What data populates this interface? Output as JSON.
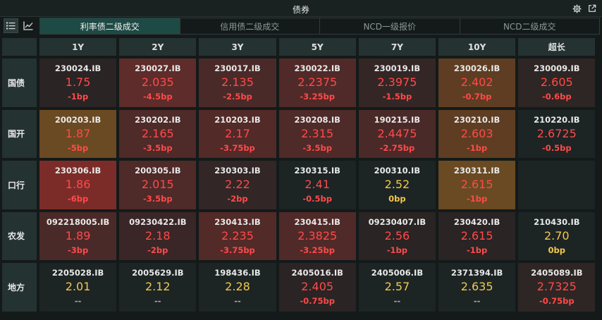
{
  "window": {
    "title": "债券"
  },
  "tabs": [
    {
      "label": "利率债二级成交",
      "active": true
    },
    {
      "label": "信用债二级成交",
      "active": false
    },
    {
      "label": "NCD一级报价",
      "active": false
    },
    {
      "label": "NCD二级成交",
      "active": false
    }
  ],
  "columns": [
    "1Y",
    "2Y",
    "3Y",
    "5Y",
    "7Y",
    "10Y",
    "超长"
  ],
  "colors": {
    "up": "#ff4a4a",
    "flat": "#f2c94c",
    "na": "#a8a8a8",
    "bg_strong_red": "#7c2c28",
    "bg_red": "#5a2a28",
    "bg_light_red": "#3a2626",
    "bg_amber": "#6a4a22",
    "bg_none": "#1d2424"
  },
  "rows": [
    {
      "label": "国债",
      "cells": [
        {
          "code": "230024.IB",
          "yield": "1.75",
          "change": "-1bp",
          "tone": "up",
          "bg": "#2a2424"
        },
        {
          "code": "230027.IB",
          "yield": "2.035",
          "change": "-4.5bp",
          "tone": "up",
          "bg": "#5e2c2a"
        },
        {
          "code": "230017.IB",
          "yield": "2.135",
          "change": "-2.5bp",
          "tone": "up",
          "bg": "#4a2a28"
        },
        {
          "code": "230022.IB",
          "yield": "2.2375",
          "change": "-3.25bp",
          "tone": "up",
          "bg": "#502a28"
        },
        {
          "code": "230019.IB",
          "yield": "2.3975",
          "change": "-1.5bp",
          "tone": "up",
          "bg": "#352626"
        },
        {
          "code": "230026.IB",
          "yield": "2.402",
          "change": "-0.7bp",
          "tone": "up",
          "bg": "#5e3d22"
        },
        {
          "code": "230009.IB",
          "yield": "2.605",
          "change": "-0.6bp",
          "tone": "up",
          "bg": "#2e2624"
        }
      ]
    },
    {
      "label": "国开",
      "cells": [
        {
          "code": "200203.IB",
          "yield": "1.87",
          "change": "-5bp",
          "tone": "up",
          "bg": "#6a4a22"
        },
        {
          "code": "230202.IB",
          "yield": "2.165",
          "change": "-3.5bp",
          "tone": "up",
          "bg": "#4e2a28"
        },
        {
          "code": "210203.IB",
          "yield": "2.17",
          "change": "-3.75bp",
          "tone": "up",
          "bg": "#522a28"
        },
        {
          "code": "230208.IB",
          "yield": "2.315",
          "change": "-3.5bp",
          "tone": "up",
          "bg": "#4e2a28"
        },
        {
          "code": "190215.IB",
          "yield": "2.4475",
          "change": "-2.75bp",
          "tone": "up",
          "bg": "#4a2a28"
        },
        {
          "code": "230210.IB",
          "yield": "2.603",
          "change": "-1bp",
          "tone": "up",
          "bg": "#5e3d22"
        },
        {
          "code": "210220.IB",
          "yield": "2.6725",
          "change": "-0.5bp",
          "tone": "up",
          "bg": "#1d2424"
        }
      ]
    },
    {
      "label": "口行",
      "cells": [
        {
          "code": "230306.IB",
          "yield": "1.86",
          "change": "-6bp",
          "tone": "up",
          "bg": "#7c2c28"
        },
        {
          "code": "200305.IB",
          "yield": "2.015",
          "change": "-3.5bp",
          "tone": "up",
          "bg": "#4e2a28"
        },
        {
          "code": "230303.IB",
          "yield": "2.22",
          "change": "-2bp",
          "tone": "up",
          "bg": "#332626"
        },
        {
          "code": "230315.IB",
          "yield": "2.41",
          "change": "-0.5bp",
          "tone": "up",
          "bg": "#1d2424"
        },
        {
          "code": "200310.IB",
          "yield": "2.52",
          "change": "0bp",
          "tone": "flat",
          "bg": "#1d2424"
        },
        {
          "code": "230311.IB",
          "yield": "2.615",
          "change": "-1bp",
          "tone": "up",
          "bg": "#6a4a22"
        },
        {
          "code": "",
          "yield": "",
          "change": "",
          "tone": "flat",
          "bg": "#1d2424"
        }
      ]
    },
    {
      "label": "农发",
      "cells": [
        {
          "code": "092218005.IB",
          "yield": "1.89",
          "change": "-3bp",
          "tone": "up",
          "bg": "#4a2a28"
        },
        {
          "code": "09230422.IB",
          "yield": "2.18",
          "change": "-2bp",
          "tone": "up",
          "bg": "#3a2626"
        },
        {
          "code": "230413.IB",
          "yield": "2.235",
          "change": "-3.75bp",
          "tone": "up",
          "bg": "#522a28"
        },
        {
          "code": "230415.IB",
          "yield": "2.3825",
          "change": "-3.25bp",
          "tone": "up",
          "bg": "#502a28"
        },
        {
          "code": "09230407.IB",
          "yield": "2.56",
          "change": "-1bp",
          "tone": "up",
          "bg": "#2a2424"
        },
        {
          "code": "230420.IB",
          "yield": "2.615",
          "change": "-1bp",
          "tone": "up",
          "bg": "#2a2424"
        },
        {
          "code": "210430.IB",
          "yield": "2.70",
          "change": "0bp",
          "tone": "flat",
          "bg": "#1d2424"
        }
      ]
    },
    {
      "label": "地方",
      "cells": [
        {
          "code": "2205028.IB",
          "yield": "2.01",
          "change": "--",
          "tone": "flat",
          "bg": "#1d2424"
        },
        {
          "code": "2005629.IB",
          "yield": "2.12",
          "change": "--",
          "tone": "flat",
          "bg": "#1d2424"
        },
        {
          "code": "198436.IB",
          "yield": "2.28",
          "change": "--",
          "tone": "flat",
          "bg": "#1d2424"
        },
        {
          "code": "2405016.IB",
          "yield": "2.405",
          "change": "-0.75bp",
          "tone": "up",
          "bg": "#2a2424"
        },
        {
          "code": "2405006.IB",
          "yield": "2.57",
          "change": "--",
          "tone": "flat",
          "bg": "#1d2424"
        },
        {
          "code": "2371394.IB",
          "yield": "2.635",
          "change": "--",
          "tone": "flat",
          "bg": "#1d2424"
        },
        {
          "code": "2405089.IB",
          "yield": "2.7325",
          "change": "-0.75bp",
          "tone": "up",
          "bg": "#2e2624"
        }
      ]
    }
  ]
}
